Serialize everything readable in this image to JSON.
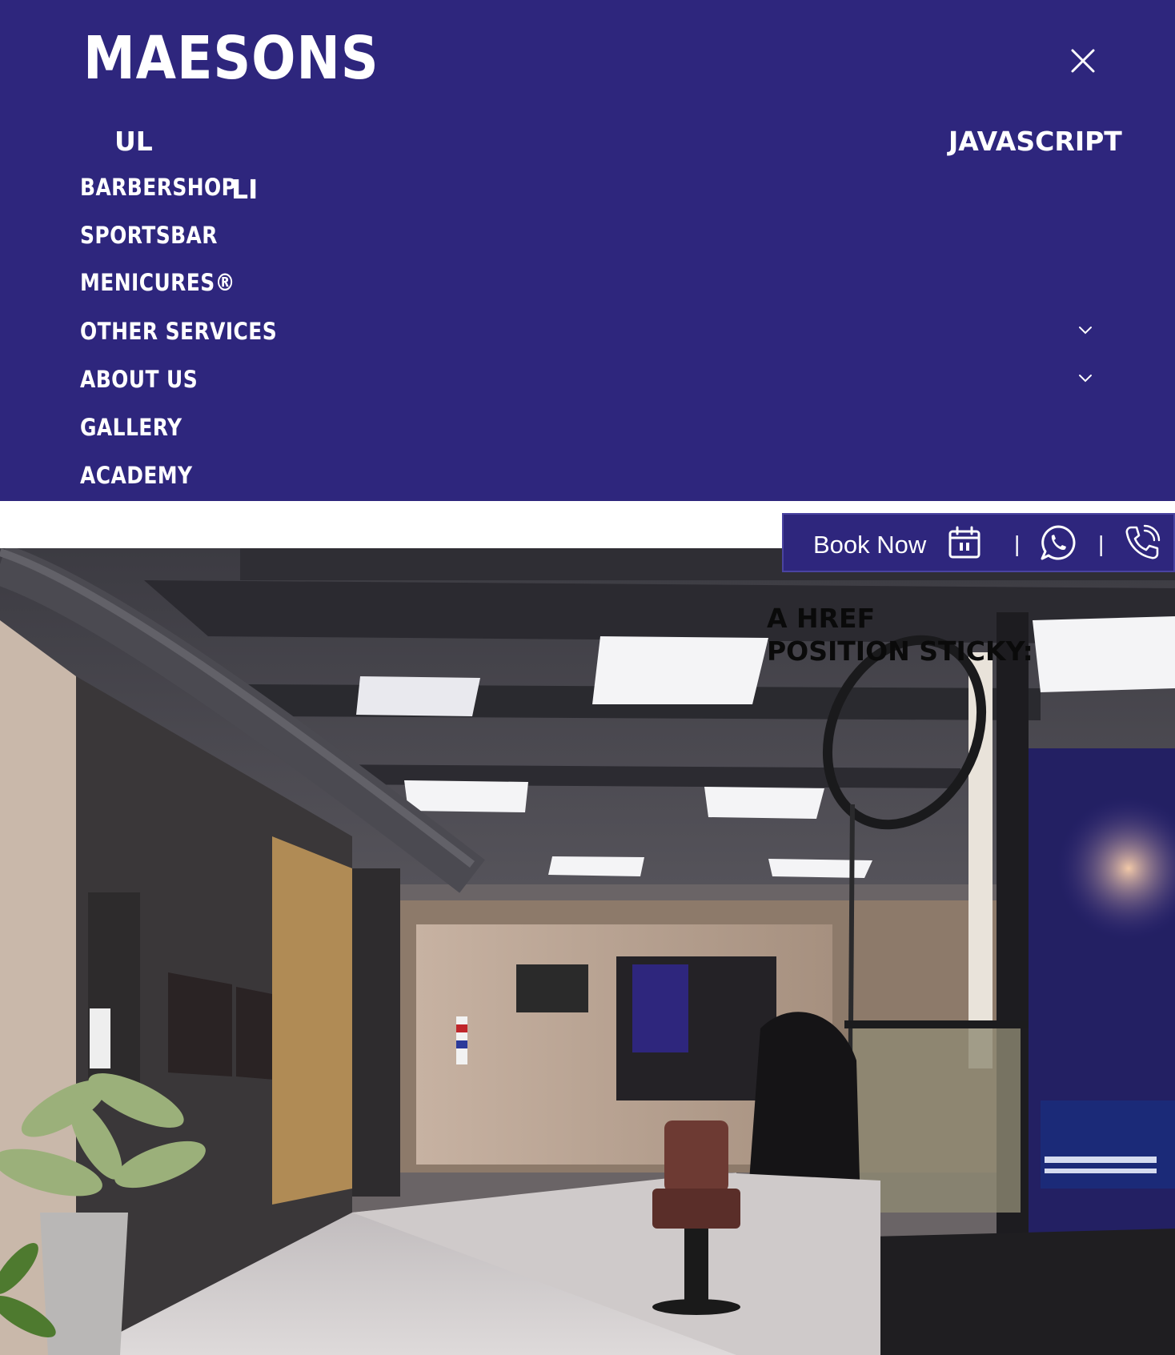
{
  "brand": {
    "logo_text": "MAESONS"
  },
  "annotations": {
    "ul": "UL",
    "javascript": "JAVASCRIPT",
    "li": "LI",
    "sticky_line1": "A HREF",
    "sticky_line2": "POSITION STICKY:"
  },
  "menu": {
    "items": [
      {
        "label": "BARBERSHOP",
        "has_submenu": false
      },
      {
        "label": "SPORTSBAR",
        "has_submenu": false
      },
      {
        "label": "MENICURES®",
        "has_submenu": false
      },
      {
        "label": "OTHER SERVICES",
        "has_submenu": true
      },
      {
        "label": "ABOUT US",
        "has_submenu": true
      },
      {
        "label": "GALLERY",
        "has_submenu": false
      },
      {
        "label": "ACADEMY",
        "has_submenu": false
      }
    ]
  },
  "booking": {
    "book_label": "Book Now",
    "separator": "|",
    "icons": [
      "calendar-icon",
      "whatsapp-icon",
      "phone-icon"
    ]
  },
  "icons": {
    "close": "close-icon",
    "chevron": "chevron-down-icon"
  },
  "colors": {
    "brand_navy": "#2e267d",
    "text_light": "#ffffff",
    "text_dark": "#0a0a0a"
  }
}
